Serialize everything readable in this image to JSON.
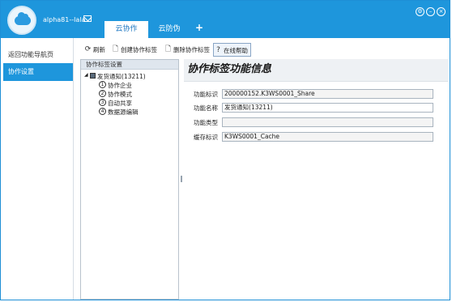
{
  "header": {
    "username": "alpha81--lala",
    "tabs": [
      {
        "label": "云协作",
        "active": true
      },
      {
        "label": "云防伪",
        "active": false
      }
    ],
    "add_tab_label": "+",
    "window_buttons": [
      "settings-icon",
      "minimize-icon",
      "maximize-icon",
      "close-icon"
    ],
    "accent_color": "#1e96dc"
  },
  "nav": {
    "items": [
      {
        "label": "返回功能导航页",
        "active": false
      },
      {
        "label": "协作设置",
        "active": true
      }
    ]
  },
  "toolbar": {
    "refresh_label": "刷新",
    "create_label": "创建协作标签",
    "delete_label": "删除协作标签",
    "help_label": "在线帮助"
  },
  "tree": {
    "header": "协作标签设置",
    "root_label": "发货通知(13211)",
    "children": [
      {
        "num": "1",
        "label": "协作企业"
      },
      {
        "num": "2",
        "label": "协作模式"
      },
      {
        "num": "3",
        "label": "自动共享"
      },
      {
        "num": "4",
        "label": "数据源编辑"
      }
    ]
  },
  "detail": {
    "title": "协作标签功能信息",
    "fields": [
      {
        "label": "功能标识",
        "value": "200000152.K3WS0001_Share"
      },
      {
        "label": "功能名称",
        "value": "发货通知(13211)"
      },
      {
        "label": "功能类型",
        "value": ""
      },
      {
        "label": "缓存标识",
        "value": "K3WS0001_Cache"
      }
    ]
  }
}
